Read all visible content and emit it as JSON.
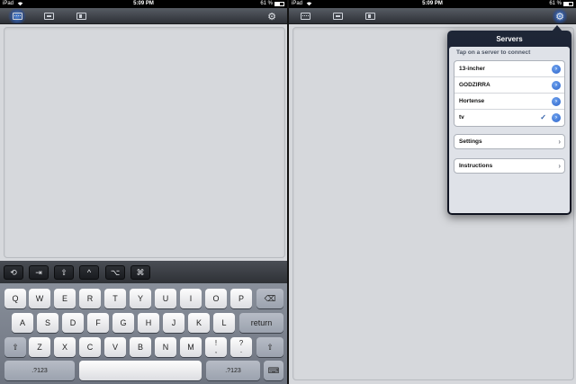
{
  "status": {
    "device": "iPad",
    "time": "5:09 PM",
    "battery": "61 %"
  },
  "toolbar": {
    "icons": [
      "keyboard-icon",
      "screen-icon",
      "media-icon",
      "gear-icon"
    ]
  },
  "modifiers": [
    "⟲",
    "⇥",
    "⇧",
    "^",
    "⌥",
    "⌘"
  ],
  "keyboard": {
    "row1": [
      "Q",
      "W",
      "E",
      "R",
      "T",
      "Y",
      "U",
      "I",
      "O",
      "P"
    ],
    "row2": [
      "A",
      "S",
      "D",
      "F",
      "G",
      "H",
      "J",
      "K",
      "L"
    ],
    "row3": [
      "Z",
      "X",
      "C",
      "V",
      "B",
      "N",
      "M"
    ],
    "return_label": "return",
    "shift": "⇧",
    "backspace": "⌫",
    "num_label": ".?123",
    "excl": [
      "!",
      ","
    ],
    "quest": [
      "?",
      "."
    ],
    "hide_kbd": "⌨"
  },
  "popover": {
    "title": "Servers",
    "subtitle": "Tap on a server to connect",
    "servers": [
      "13-incher",
      "GODZIRRA",
      "Hortense",
      "tv"
    ],
    "selected_server": "tv",
    "check": "✓",
    "settings_label": "Settings",
    "instructions_label": "Instructions"
  }
}
